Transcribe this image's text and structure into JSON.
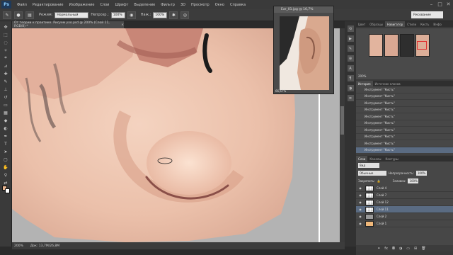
{
  "menubar": {
    "logo": "Ps",
    "items": [
      "Файл",
      "Редактирование",
      "Изображение",
      "Слои",
      "Шрифт",
      "Выделение",
      "Фильтр",
      "3D",
      "Просмотр",
      "Окно",
      "Справка"
    ]
  },
  "options": {
    "mode_label": "Режим:",
    "mode_value": "Нормальный",
    "opacity_label": "Непрозр.:",
    "opacity_value": "100%",
    "pressure_label": "Наж.:",
    "pressure_value": "100%",
    "workspace": "Рисование"
  },
  "document": {
    "tab_title": "От теории к практике. Рисуем ухо.psd @ 200% (Слой 11, RGB/8) *",
    "zoom": "200%",
    "doc_size": "Док: 13,7М/26,8М"
  },
  "float_window": {
    "title": "Ear_01.jpg @ 16,7%",
    "zoom": "66,67%"
  },
  "navigator": {
    "tabs": [
      "Цвет",
      "Образцы",
      "Навигатор",
      "Стили",
      "Кисть",
      "Инфо"
    ],
    "zoom": "200%"
  },
  "history": {
    "tabs": [
      "История",
      "Источник клонов"
    ],
    "items": [
      "Инструмент \"Кисть\"",
      "Инструмент \"Кисть\"",
      "Инструмент \"Кисть\"",
      "Инструмент \"Кисть\"",
      "Инструмент \"Кисть\"",
      "Инструмент \"Кисть\"",
      "Инструмент \"Кисть\"",
      "Инструмент \"Кисть\"",
      "Инструмент \"Кисть\"",
      "Инструмент \"Кисть\""
    ]
  },
  "layers": {
    "tabs": [
      "Слои",
      "Каналы",
      "Контуры"
    ],
    "filter": "Вид",
    "blend_mode": "Обычные",
    "opacity_label": "Непрозрачность:",
    "opacity_value": "100%",
    "lock_label": "Закрепить:",
    "fill_label": "Заливка:",
    "fill_value": "100%",
    "items": [
      {
        "name": "Слой 4",
        "selected": false
      },
      {
        "name": "Слой 7",
        "selected": false
      },
      {
        "name": "Слой 12",
        "selected": false
      },
      {
        "name": "Слой 11",
        "selected": true
      },
      {
        "name": "Слой 2",
        "selected": false
      },
      {
        "name": "Слой 1",
        "selected": false
      }
    ]
  }
}
